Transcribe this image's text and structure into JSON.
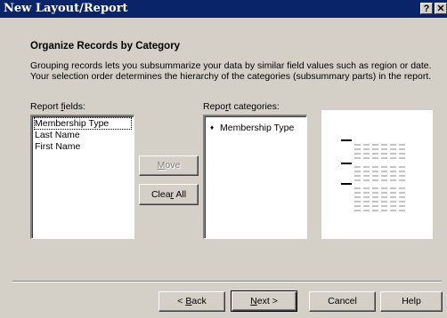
{
  "window": {
    "title": "New Layout/Report",
    "help_glyph": "?",
    "close_glyph": "✕"
  },
  "heading": "Organize Records by Category",
  "description": "Grouping records lets you subsummarize your data by similar field values such as region or date. Your selection order determines the hierarchy of the categories (subsummary parts) in the report.",
  "report_fields": {
    "label_pre": "Report ",
    "label_accel": "f",
    "label_post": "ields:",
    "items": [
      "Membership Type",
      "Last Name",
      "First Name"
    ]
  },
  "report_categories": {
    "label_pre": "Repo",
    "label_accel": "r",
    "label_post": "t categories:",
    "items": [
      {
        "bullet": "♦",
        "label": "Membership Type"
      }
    ]
  },
  "buttons": {
    "move": {
      "accel": "M",
      "rest": "ove",
      "disabled": true
    },
    "clear_all": {
      "pre": "Clea",
      "accel": "r",
      "post": " All"
    },
    "back": {
      "pre": "< ",
      "accel": "B",
      "post": "ack"
    },
    "next": {
      "pre": "",
      "accel": "N",
      "post": "ext >"
    },
    "cancel": "Cancel",
    "help": "Help"
  },
  "preview_icon": "report-layout-preview-icon"
}
